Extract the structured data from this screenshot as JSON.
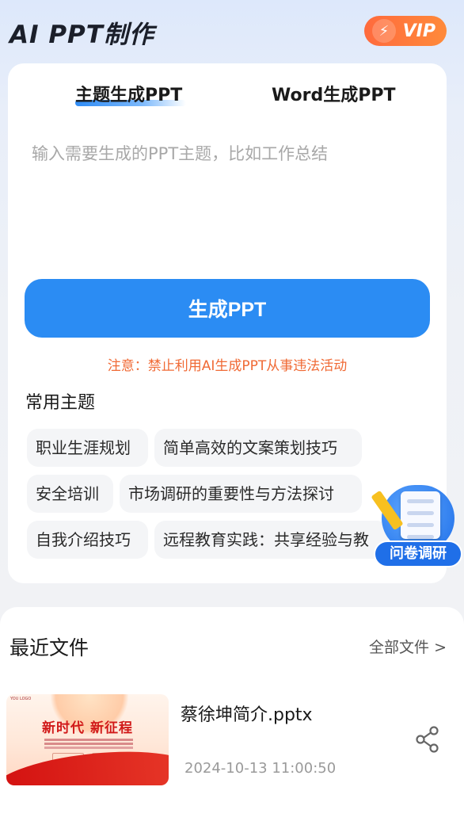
{
  "header": {
    "app_title": "AI PPT制作",
    "vip_label": "VIP"
  },
  "generator": {
    "tabs": [
      {
        "label": "主题生成PPT",
        "active": true
      },
      {
        "label": "Word生成PPT",
        "active": false
      }
    ],
    "input_placeholder": "输入需要生成的PPT主题，比如工作总结",
    "generate_button": "生成PPT",
    "notice": "注意：禁止利用AI生成PPT从事违法活动",
    "common_topics_title": "常用主题",
    "topics": [
      "职业生涯规划",
      "简单高效的文案策划技巧",
      "安全培训",
      "市场调研的重要性与方法探讨",
      "自我介绍技巧",
      "远程教育实践：共享经验与教"
    ]
  },
  "survey_widget": {
    "label": "问卷调研"
  },
  "recent": {
    "title": "最近文件",
    "all_files_link": "全部文件 >",
    "files": [
      {
        "name": "蔡徐坤简介.pptx",
        "time": "2024-10-13 11:00:50",
        "thumbnail_title": "新时代  新征程",
        "thumbnail_logo": "YOU LOGO"
      }
    ]
  },
  "colors": {
    "primary_blue": "#2b8cf3",
    "notice_orange": "#f06a35",
    "vip_orange": "#ff6a3d"
  }
}
